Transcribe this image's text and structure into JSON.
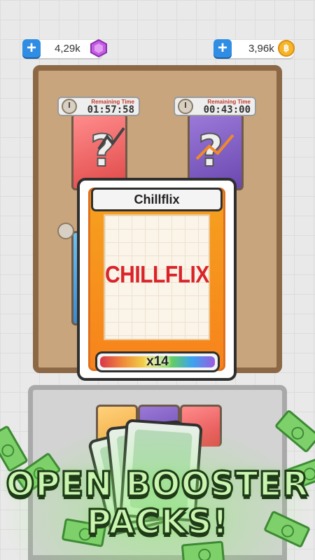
{
  "currency": {
    "gems": {
      "value": "4,29k",
      "icon": "gem-icon",
      "color": "#b44fd6"
    },
    "coins": {
      "value": "3,96k",
      "icon": "coin-icon",
      "symbol": "฿",
      "color": "#f6b52a"
    }
  },
  "timers": [
    {
      "caption": "Remaining Time",
      "time": "01:57:58"
    },
    {
      "caption": "Remaining Time",
      "time": "00:43:00"
    }
  ],
  "card": {
    "title": "Chillflix",
    "brand": "CHILLFLIX",
    "multiplier": "x14"
  },
  "banner": {
    "line1": "OPEN BOOSTER",
    "line2": "PACKS!"
  },
  "colors": {
    "accent_blue": "#2f8de4",
    "card_orange": "#f7831b",
    "brand_red": "#d9242a",
    "banner_green": "#c9f5b0"
  }
}
